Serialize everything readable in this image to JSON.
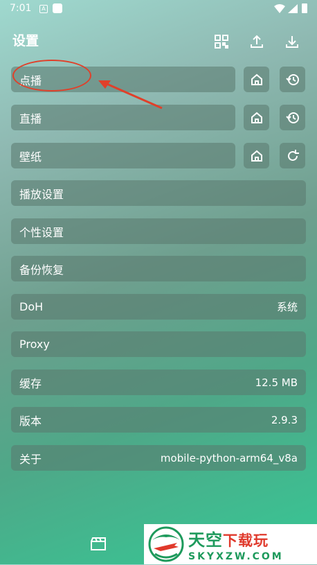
{
  "status_bar": {
    "time": "7:01",
    "notif_a": "A"
  },
  "header": {
    "title": "设置"
  },
  "rows": {
    "vod": "点播",
    "live": "直播",
    "wallpaper": "壁纸",
    "playback": "播放设置",
    "personal": "个性设置",
    "backup": "备份恢复",
    "doh": {
      "label": "DoH",
      "value": "系统"
    },
    "proxy": {
      "label": "Proxy"
    },
    "cache": {
      "label": "缓存",
      "value": "12.5 MB"
    },
    "version": {
      "label": "版本",
      "value": "2.9.3"
    },
    "about": {
      "label": "关于",
      "value": "mobile-python-arm64_v8a"
    }
  },
  "watermark": {
    "line1_a": "天空",
    "line1_b": "下载玩",
    "line2": "SKYXZW.COM"
  },
  "colors": {
    "highlight": "#e0402a",
    "brand_green": "#1e9a5c",
    "brand_red": "#e0392b"
  }
}
